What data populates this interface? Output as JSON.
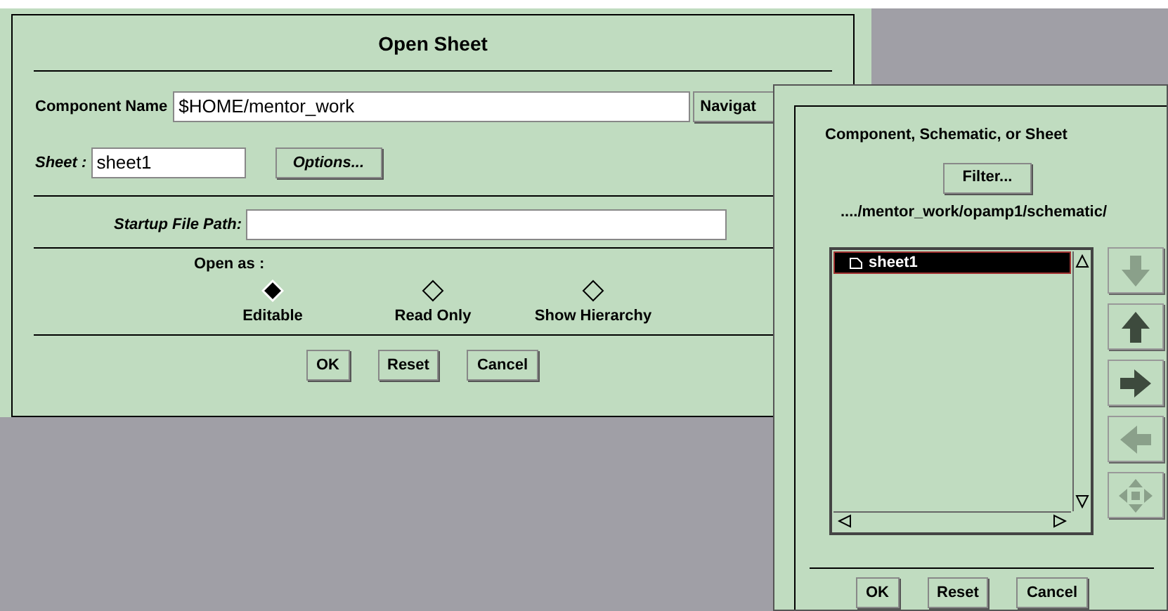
{
  "open_sheet": {
    "title": "Open Sheet",
    "component_name": {
      "label": "Component Name",
      "value": "$HOME/mentor_work",
      "button": "Navigat"
    },
    "sheet": {
      "label": "Sheet :",
      "value": "sheet1",
      "button": "Options..."
    },
    "startup_file_path": {
      "label": "Startup File Path:"
    },
    "open_as": {
      "label": "Open as :",
      "options": [
        {
          "label": "Editable",
          "selected": true
        },
        {
          "label": "Read Only",
          "selected": false
        },
        {
          "label": "Show Hierarchy",
          "selected": false
        }
      ]
    },
    "buttons": [
      "OK",
      "Reset",
      "Cancel"
    ]
  },
  "navigator": {
    "title": "Component, Schematic, or Sheet",
    "filter_button": "Filter...",
    "path": "..../mentor_work/opamp1/schematic/",
    "items": [
      {
        "label": "sheet1",
        "selected": true
      }
    ],
    "arrow_buttons": [
      {
        "kind": "down",
        "disabled": true
      },
      {
        "kind": "up",
        "disabled": false
      },
      {
        "kind": "right",
        "disabled": false
      },
      {
        "kind": "left",
        "disabled": true
      },
      {
        "kind": "move",
        "disabled": true
      }
    ],
    "buttons": [
      "OK",
      "Reset",
      "Cancel"
    ]
  }
}
